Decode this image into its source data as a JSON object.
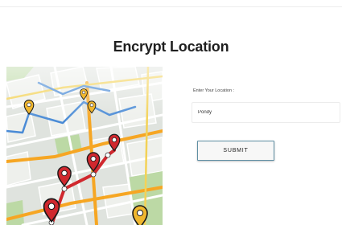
{
  "page": {
    "title": "Encrypt Location"
  },
  "form": {
    "location_label": "Enter Your Location :",
    "location_value": "Pondy",
    "submit_label": "SUBMIT"
  },
  "colors": {
    "route_red": "#d0282e",
    "route_orange": "#f6a623",
    "route_blue": "#4a8bd6",
    "button_border": "#5f8fa4"
  },
  "icons": [
    "map-pin-icon"
  ]
}
